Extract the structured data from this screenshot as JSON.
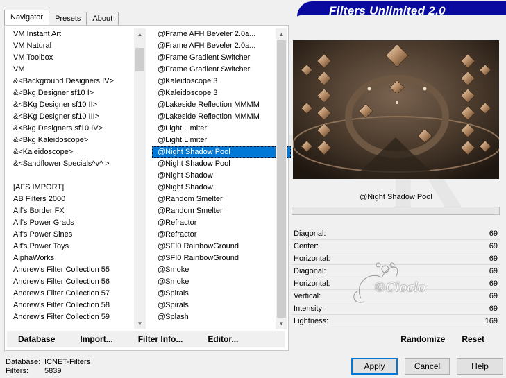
{
  "window": {
    "banner_title": "Filters Unlimited 2.0"
  },
  "tabs": [
    {
      "label": "Navigator",
      "active": true
    },
    {
      "label": "Presets",
      "active": false
    },
    {
      "label": "About",
      "active": false
    }
  ],
  "categories": [
    "VM Instant Art",
    "VM Natural",
    "VM Toolbox",
    "VM",
    "&<Background Designers IV>",
    "&<Bkg Designer sf10 I>",
    "&<BKg Designer sf10 II>",
    "&<BKg Designer sf10 III>",
    "&<Bkg Designers sf10 IV>",
    "&<Bkg Kaleidoscope>",
    "&<Kaleidoscope>",
    "&<Sandflower Specials^v^ >",
    "",
    "[AFS IMPORT]",
    "AB Filters 2000",
    "Alf's Border FX",
    "Alf's Power Grads",
    "Alf's Power Sines",
    "Alf's Power Toys",
    "AlphaWorks",
    "Andrew's Filter Collection 55",
    "Andrew's Filter Collection 56",
    "Andrew's Filter Collection 57",
    "Andrew's Filter Collection 58",
    "Andrew's Filter Collection 59"
  ],
  "filters": [
    "@Frame AFH Beveler 2.0a...",
    "@Frame AFH Beveler 2.0a...",
    "@Frame Gradient Switcher",
    "@Frame Gradient Switcher",
    "@Kaleidoscope 3",
    "@Kaleidoscope 3",
    "@Lakeside Reflection MMMM",
    "@Lakeside Reflection MMMM",
    "@Light Limiter",
    "@Light Limiter",
    "@Night Shadow Pool",
    "@Night Shadow Pool",
    "@Night Shadow",
    "@Night Shadow",
    "@Random Smelter",
    "@Random Smelter",
    "@Refractor",
    "@Refractor",
    "@SFI0 RainbowGround",
    "@SFI0 RainbowGround",
    "@Smoke",
    "@Smoke",
    "@Spirals",
    "@Spirals",
    "@Splash"
  ],
  "selected_filter_index": 10,
  "toolbar": {
    "database_label": "Database",
    "import_label": "Import...",
    "filter_info_label": "Filter Info...",
    "editor_label": "Editor..."
  },
  "preview": {
    "filter_name": "@Night Shadow Pool"
  },
  "parameters": [
    {
      "label": "Diagonal:",
      "value": "69"
    },
    {
      "label": "Center:",
      "value": "69"
    },
    {
      "label": "Horizontal:",
      "value": "69"
    },
    {
      "label": "Diagonal:",
      "value": "69"
    },
    {
      "label": "Horizontal:",
      "value": "69"
    },
    {
      "label": "Vertical:",
      "value": "69"
    },
    {
      "label": "Intensity:",
      "value": "69"
    },
    {
      "label": "Lightness:",
      "value": "169"
    }
  ],
  "right_toolbar": {
    "randomize_label": "Randomize",
    "reset_label": "Reset"
  },
  "status": {
    "database_key": "Database:",
    "database_value": "ICNET-Filters",
    "filters_key": "Filters:",
    "filters_value": "5839"
  },
  "watermark": {
    "text": "©Cloclo"
  },
  "buttons": {
    "apply": "Apply",
    "cancel": "Cancel",
    "help": "Help"
  },
  "colors": {
    "banner": "#0a0aa0",
    "selection": "#0078d7",
    "default_button_border": "#0078d7"
  }
}
